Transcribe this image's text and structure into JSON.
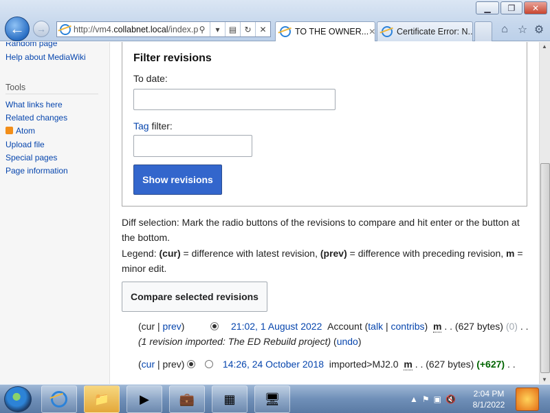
{
  "browser": {
    "address_prefix": "http://vm4.",
    "address_host": "collabnet.local",
    "address_suffix": "/index.p",
    "tabs": [
      {
        "title": "TO THE OWNER...",
        "active": true
      },
      {
        "title": "Certificate Error: N...",
        "active": false
      }
    ],
    "window_buttons": {
      "minimize": "▁",
      "maximize": "❐",
      "close": "✕"
    }
  },
  "sidebar": {
    "items_top": [
      "Random page",
      "Help about MediaWiki"
    ],
    "tools_heading": "Tools",
    "tools": [
      "What links here",
      "Related changes",
      "Atom",
      "Upload file",
      "Special pages",
      "Page information"
    ]
  },
  "filter": {
    "title": "Filter revisions",
    "to_date_label": "To date:",
    "tag_link": "Tag",
    "tag_rest": " filter:",
    "show_button": "Show revisions"
  },
  "diff_help": {
    "selection": "Diff selection: Mark the radio buttons of the revisions to compare and hit enter or the button at the bottom.",
    "legend_prefix": "Legend: ",
    "cur_label": "(cur)",
    "cur_desc": " = difference with latest revision, ",
    "prev_label": "(prev)",
    "prev_desc": " = difference with preceding revision, ",
    "m_label": "m",
    "m_desc": " = minor edit."
  },
  "compare_button": "Compare selected revisions",
  "revisions": [
    {
      "cur": "cur",
      "prev": "prev",
      "date": "21:02, 1 August 2022",
      "user": "Account",
      "talk": "talk",
      "contribs": "contribs",
      "minor": "m",
      "size": "(627 bytes)",
      "change": "(0)",
      "comment": "(1 revision imported: The ED Rebuild project)",
      "undo": "undo"
    },
    {
      "cur": "cur",
      "prev": "prev",
      "date": "14:26, 24 October 2018",
      "user": "imported>MJ2.0",
      "minor": "m",
      "size": "(627 bytes)",
      "change": "(+627)"
    }
  ],
  "taskbar": {
    "clock_time": "2:04 PM",
    "clock_date": "8/1/2022"
  }
}
